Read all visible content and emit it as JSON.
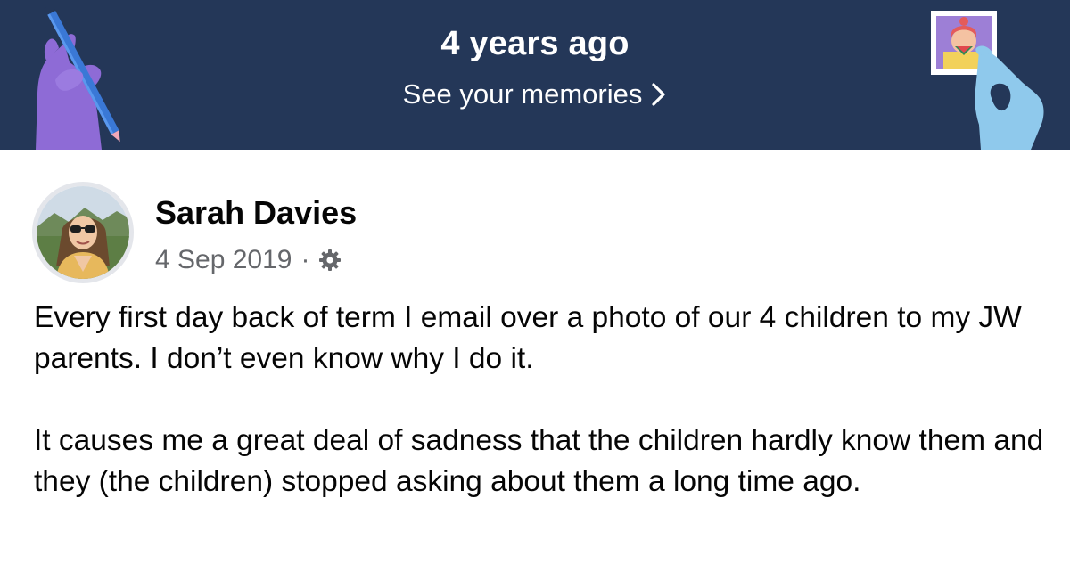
{
  "colors": {
    "banner_bg": "#243758",
    "banner_text": "#ffffff",
    "author_text": "#050505",
    "meta_text": "#65676b",
    "body_text": "#050505"
  },
  "banner": {
    "title": "4 years ago",
    "link_label": "See your memories",
    "chevron_icon": "chevron-right-icon",
    "left_illustration": "hand-with-pencil-illustration",
    "right_illustration": "hand-holding-photo-illustration"
  },
  "post": {
    "author": "Sarah Davies",
    "date": "4 Sep 2019",
    "separator": "·",
    "privacy_icon": "gear-icon",
    "paragraphs": [
      "Every first day back of term I email over a photo of our 4 children to my JW parents. I don’t even know why I do it.",
      "It causes me a great deal of sadness that the children hardly know them and they (the children) stopped asking about them a long time ago."
    ]
  }
}
